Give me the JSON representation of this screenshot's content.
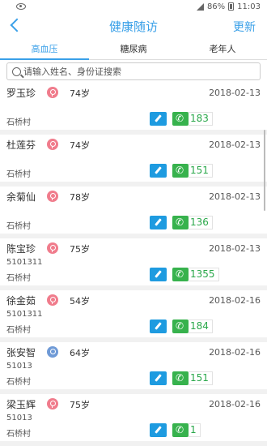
{
  "status": {
    "battery": "86%",
    "time": "11:03"
  },
  "header": {
    "title": "健康随访",
    "refresh": "更新"
  },
  "tabs": [
    {
      "label": "高血压",
      "active": true
    },
    {
      "label": "糖尿病",
      "active": false
    },
    {
      "label": "老年人",
      "active": false
    }
  ],
  "search": {
    "placeholder": "请输入姓名、身份证搜索"
  },
  "patients": [
    {
      "name": "罗玉珍",
      "gender": "female",
      "age": "74岁",
      "date": "2018-02-13",
      "id": "",
      "village": "石桥村",
      "phone": "183"
    },
    {
      "name": "杜莲芬",
      "gender": "female",
      "age": "74岁",
      "date": "2018-02-13",
      "id": "",
      "village": "石桥村",
      "phone": "151"
    },
    {
      "name": "余菊仙",
      "gender": "female",
      "age": "78岁",
      "date": "2018-02-13",
      "id": "",
      "village": "石桥村",
      "phone": "136"
    },
    {
      "name": "陈宝珍",
      "gender": "female",
      "age": "75岁",
      "date": "2018-02-13",
      "id": "5101311",
      "village": "石桥村",
      "phone": "1355"
    },
    {
      "name": "徐金茹",
      "gender": "female",
      "age": "54岁",
      "date": "2018-02-16",
      "id": "5101311",
      "village": "石桥村",
      "phone": "184"
    },
    {
      "name": "张安智",
      "gender": "male",
      "age": "64岁",
      "date": "2018-02-16",
      "id": "51013",
      "village": "石桥村",
      "phone": "151"
    },
    {
      "name": "梁玉辉",
      "gender": "female",
      "age": "75岁",
      "date": "2018-02-16",
      "id": "51013",
      "village": "石桥村",
      "phone": "1"
    }
  ]
}
